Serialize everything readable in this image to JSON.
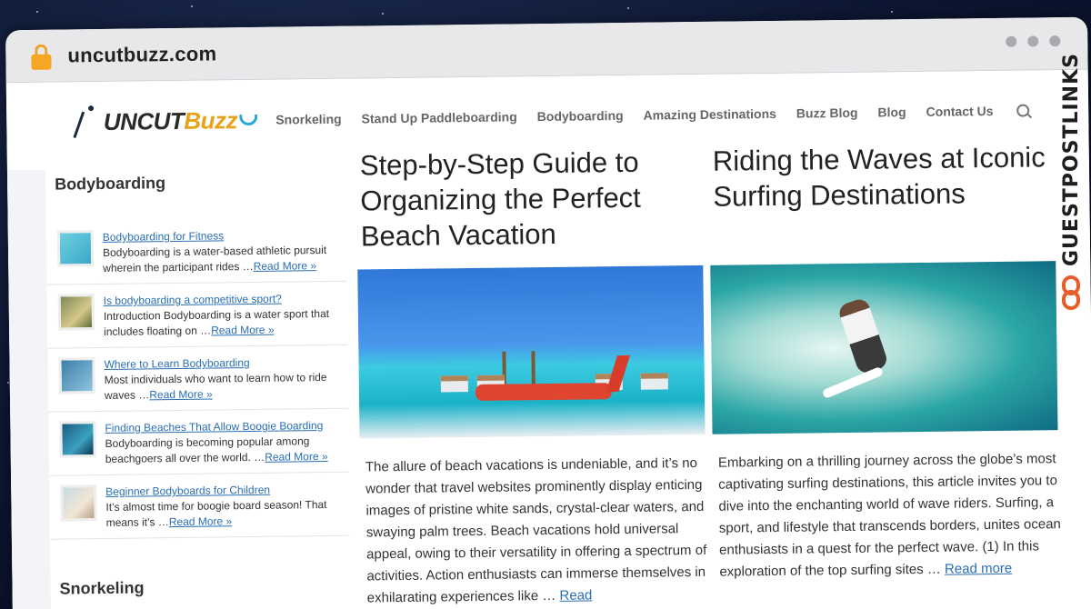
{
  "browser": {
    "url": "uncutbuzz.com"
  },
  "site": {
    "logo_part1": "UNCUT",
    "logo_part2": "Buzz",
    "nav": [
      "Snorkeling",
      "Stand Up Paddleboarding",
      "Bodyboarding",
      "Amazing Destinations",
      "Buzz Blog",
      "Blog",
      "Contact Us"
    ]
  },
  "sidebar": {
    "widget1_title": "Bodyboarding",
    "read_more": "Read More »",
    "posts": [
      {
        "title": "Bodyboarding for Fitness",
        "excerpt": "Bodyboarding is a water-based athletic pursuit wherein the participant rides …"
      },
      {
        "title": "Is bodyboarding a competitive sport?",
        "excerpt": "Introduction Bodyboarding is a water sport that includes floating on …"
      },
      {
        "title": "Where to Learn Bodyboarding",
        "excerpt": "Most individuals who want to learn how to ride waves …"
      },
      {
        "title": "Finding Beaches That Allow Boogie Boarding",
        "excerpt": "Bodyboarding is becoming popular among beachgoers all over the world. …"
      },
      {
        "title": "Beginner Bodyboards for Children",
        "excerpt": "It’s almost time for boogie board season! That means it’s …"
      }
    ],
    "widget2_title": "Snorkeling"
  },
  "articles": [
    {
      "title": "Step-by-Step Guide to Organizing the Perfect Beach Vacation",
      "excerpt": "The allure of beach vacations is undeniable, and it’s no wonder that travel websites prominently display enticing images of pristine white sands, crystal-clear waters, and swaying palm trees. Beach vacations hold universal appeal, owing to their versatility in offering a spectrum of activities. Action enthusiasts can immerse themselves in exhilarating experiences like …",
      "read_more": "Read"
    },
    {
      "title": "Riding the Waves at Iconic Surfing Destinations",
      "excerpt": "Embarking on a thrilling journey across the globe’s most captivating surfing destinations, this article invites you to dive into the enchanting world of wave riders. Surfing, a sport, and lifestyle that transcends borders, unites ocean enthusiasts in a quest for the perfect wave. (1) In this exploration of the top surfing sites …",
      "read_more": "Read more"
    }
  ],
  "watermark": {
    "text": "GUESTPOSTLINKS",
    "accent": "#e85d2a"
  }
}
